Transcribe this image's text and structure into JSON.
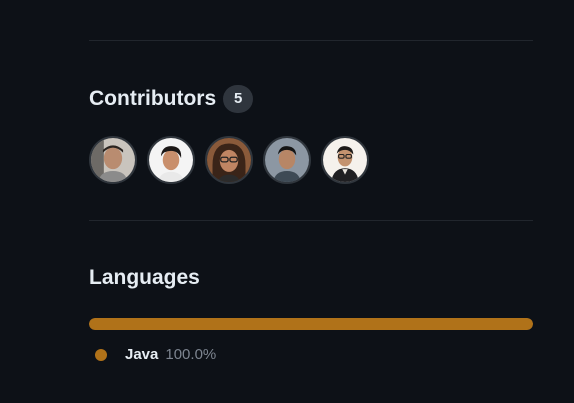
{
  "contributors": {
    "title": "Contributors",
    "count": "5",
    "avatars": [
      {
        "name": "avatar-contributor-1"
      },
      {
        "name": "avatar-contributor-2"
      },
      {
        "name": "avatar-contributor-3"
      },
      {
        "name": "avatar-contributor-4"
      },
      {
        "name": "avatar-contributor-5"
      }
    ]
  },
  "languages": {
    "title": "Languages",
    "items": [
      {
        "name": "Java",
        "percent": "100.0%",
        "share": 1.0,
        "color": "#b07219"
      }
    ]
  },
  "colors": {
    "background": "#0d1117",
    "divider": "#21262d",
    "java": "#b07219",
    "muted_text": "#7d8590"
  }
}
